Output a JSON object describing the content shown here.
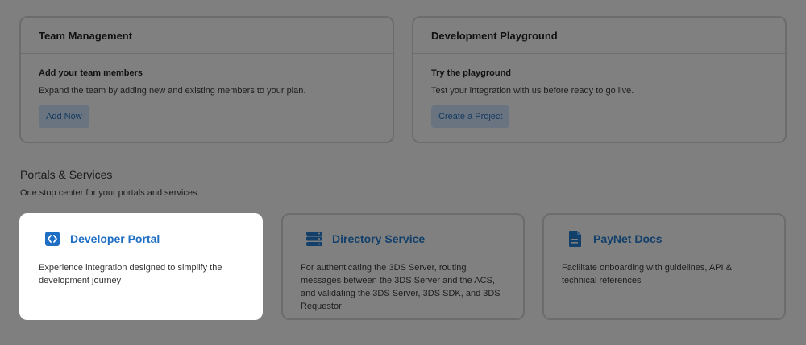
{
  "team_card": {
    "title": "Team Management",
    "subtitle": "Add your team members",
    "description": "Expand the team by adding new and existing members to your plan.",
    "button_label": "Add Now"
  },
  "playground_card": {
    "title": "Development Playground",
    "subtitle": "Try the playground",
    "description": "Test your integration with us before ready to go live.",
    "button_label": "Create a Project"
  },
  "portals": {
    "title": "Portals & Services",
    "subtitle": "One stop center for your portals and services.",
    "items": [
      {
        "title": "Developer Portal",
        "icon": "code-icon",
        "description": "Experience integration designed to simplify the development journey"
      },
      {
        "title": "Directory Service",
        "icon": "server-icon",
        "description": "For authenticating the 3DS Server, routing messages between the 3DS Server and the ACS, and validating the 3DS Server, 3DS SDK, and 3DS Requestor"
      },
      {
        "title": "PayNet Docs",
        "icon": "document-icon",
        "description": "Facilitate onboarding with guidelines, API & technical references"
      }
    ]
  },
  "colors": {
    "accent": "#1e6ec4",
    "overlay": "#7f7f7f"
  }
}
